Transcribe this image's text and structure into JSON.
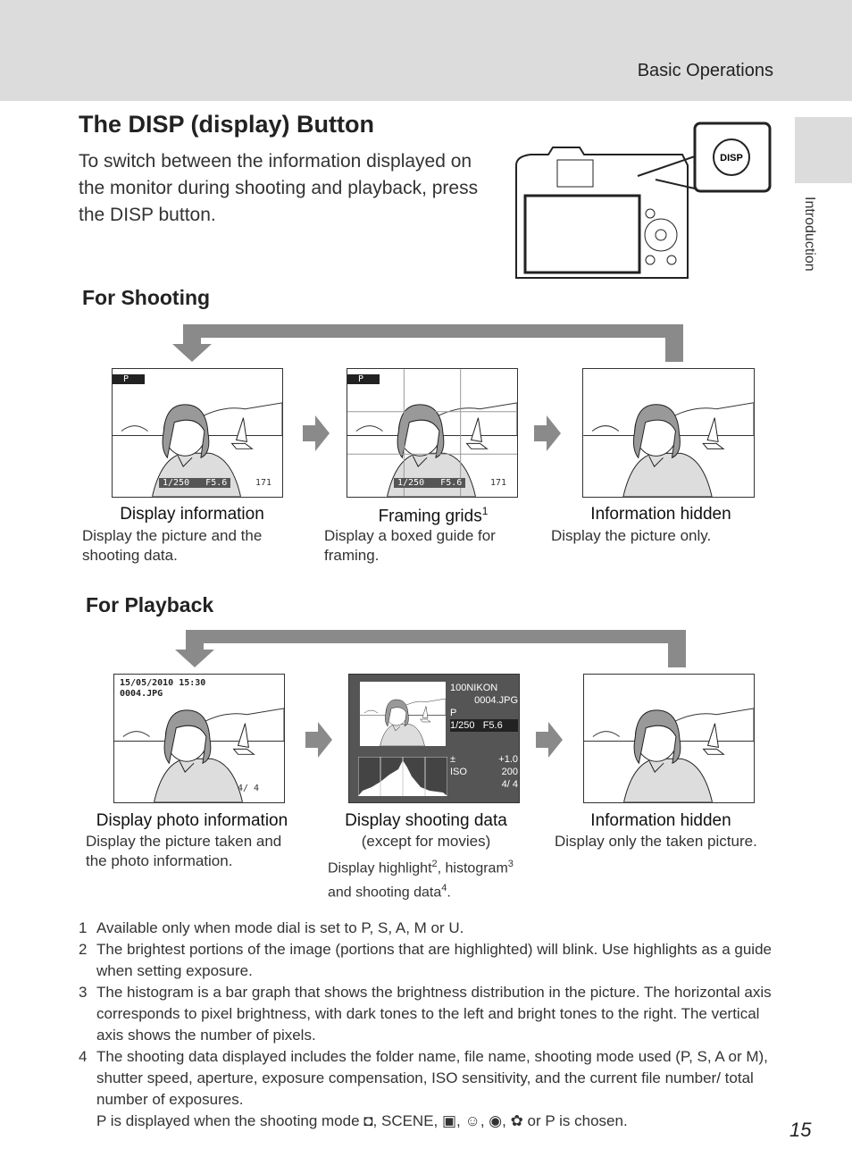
{
  "header": {
    "section": "Basic Operations"
  },
  "title": "The DISP (display) Button",
  "intro": "To switch between the information displayed on the monitor during shooting and playback, press the DISP button.",
  "camera": {
    "button_label": "DISP"
  },
  "side_tab": "Introduction",
  "shooting": {
    "heading": "For Shooting",
    "items": [
      {
        "title": "Display information",
        "desc": "Display the picture and the shooting data.",
        "mode": "P",
        "shutter": "1/250",
        "aperture": "F5.6",
        "count": "171"
      },
      {
        "title": "Framing grids",
        "sup": "1",
        "desc": "Display a boxed guide for framing.",
        "mode": "P",
        "shutter": "1/250",
        "aperture": "F5.6",
        "count": "171"
      },
      {
        "title": "Information hidden",
        "desc": "Display the picture only."
      }
    ]
  },
  "playback": {
    "heading": "For Playback",
    "items": [
      {
        "title": "Display photo information",
        "desc": "Display the picture taken and the photo information.",
        "datetime": "15/05/2010 15:30",
        "file": "0004.JPG",
        "count": "4/    4"
      },
      {
        "title": "Display shooting data",
        "subtitle": "(except for movies)",
        "desc_a": "Display highlight",
        "sup_a": "2",
        "desc_b": ", histogram",
        "sup_b": "3",
        "desc_c": "and shooting data",
        "sup_c": "4",
        "desc_end": ".",
        "folder": "100NIKON",
        "file": "0004.JPG",
        "mode": "P",
        "shutter": "1/250",
        "aperture": "F5.6",
        "exp_comp": "+1.0",
        "iso_label": "ISO",
        "iso": "200",
        "count": "4/    4"
      },
      {
        "title": "Information hidden",
        "desc": "Display only the taken picture."
      }
    ]
  },
  "footnotes": [
    {
      "n": "1",
      "text": "Available only when mode dial is set to P, S, A, M or U."
    },
    {
      "n": "2",
      "text": "The brightest portions of the image (portions that are highlighted) will blink. Use highlights as a guide when setting exposure."
    },
    {
      "n": "3",
      "text": "The histogram is a bar graph that shows the brightness distribution in the picture. The horizontal axis corresponds to pixel brightness, with dark tones to the left and bright tones to the right. The vertical axis shows the number of pixels."
    },
    {
      "n": "4",
      "text": "The shooting data displayed includes the folder name, file name, shooting mode used (P, S, A or M), shutter speed, aperture, exposure compensation, ISO sensitivity, and the current file number/ total number of exposures.",
      "extra": "P is displayed when the shooting mode ◘, SCENE, ▣, ☺, ◉, ✿ or P is chosen."
    }
  ],
  "page_number": "15"
}
